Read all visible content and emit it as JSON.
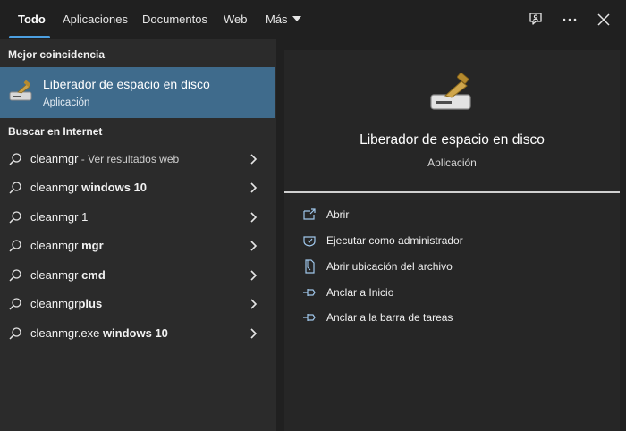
{
  "tabs": [
    {
      "label": "Todo",
      "active": true
    },
    {
      "label": "Aplicaciones"
    },
    {
      "label": "Documentos"
    },
    {
      "label": "Web"
    },
    {
      "label": "Más"
    }
  ],
  "toolbar_icons": [
    "feedback-icon",
    "more-options-icon",
    "close-icon"
  ],
  "left": {
    "best_match_heading": "Mejor coincidencia",
    "best_match": {
      "title": "Liberador de espacio en disco",
      "subtitle": "Aplicación",
      "icon": "disk-cleanup-icon"
    },
    "web_heading": "Buscar en Internet",
    "results": [
      {
        "text": "cleanmgr",
        "bold": "",
        "hint": " - Ver resultados web"
      },
      {
        "text": "cleanmgr ",
        "bold": "windows 10",
        "hint": ""
      },
      {
        "text": "cleanmgr 1",
        "bold": "",
        "hint": ""
      },
      {
        "text": "cleanmgr ",
        "bold": "mgr",
        "hint": ""
      },
      {
        "text": "cleanmgr ",
        "bold": "cmd",
        "hint": ""
      },
      {
        "text": "cleanmgr",
        "bold": "plus",
        "hint": ""
      },
      {
        "text": "cleanmgr.exe ",
        "bold": "windows 10",
        "hint": ""
      }
    ]
  },
  "right": {
    "app_title": "Liberador de espacio en disco",
    "app_subtitle": "Aplicación",
    "actions": [
      {
        "label": "Abrir",
        "icon": "open-icon"
      },
      {
        "label": "Ejecutar como administrador",
        "icon": "shield-icon"
      },
      {
        "label": "Abrir ubicación del archivo",
        "icon": "file-location-icon"
      },
      {
        "label": "Anclar a Inicio",
        "icon": "pin-icon"
      },
      {
        "label": "Anclar a la barra de tareas",
        "icon": "pin-icon"
      }
    ]
  },
  "colors": {
    "accent": "#4c9fe0",
    "selection": "#3f6b8c",
    "left_panel": "#2b2b2b",
    "right_panel": "#262626"
  }
}
